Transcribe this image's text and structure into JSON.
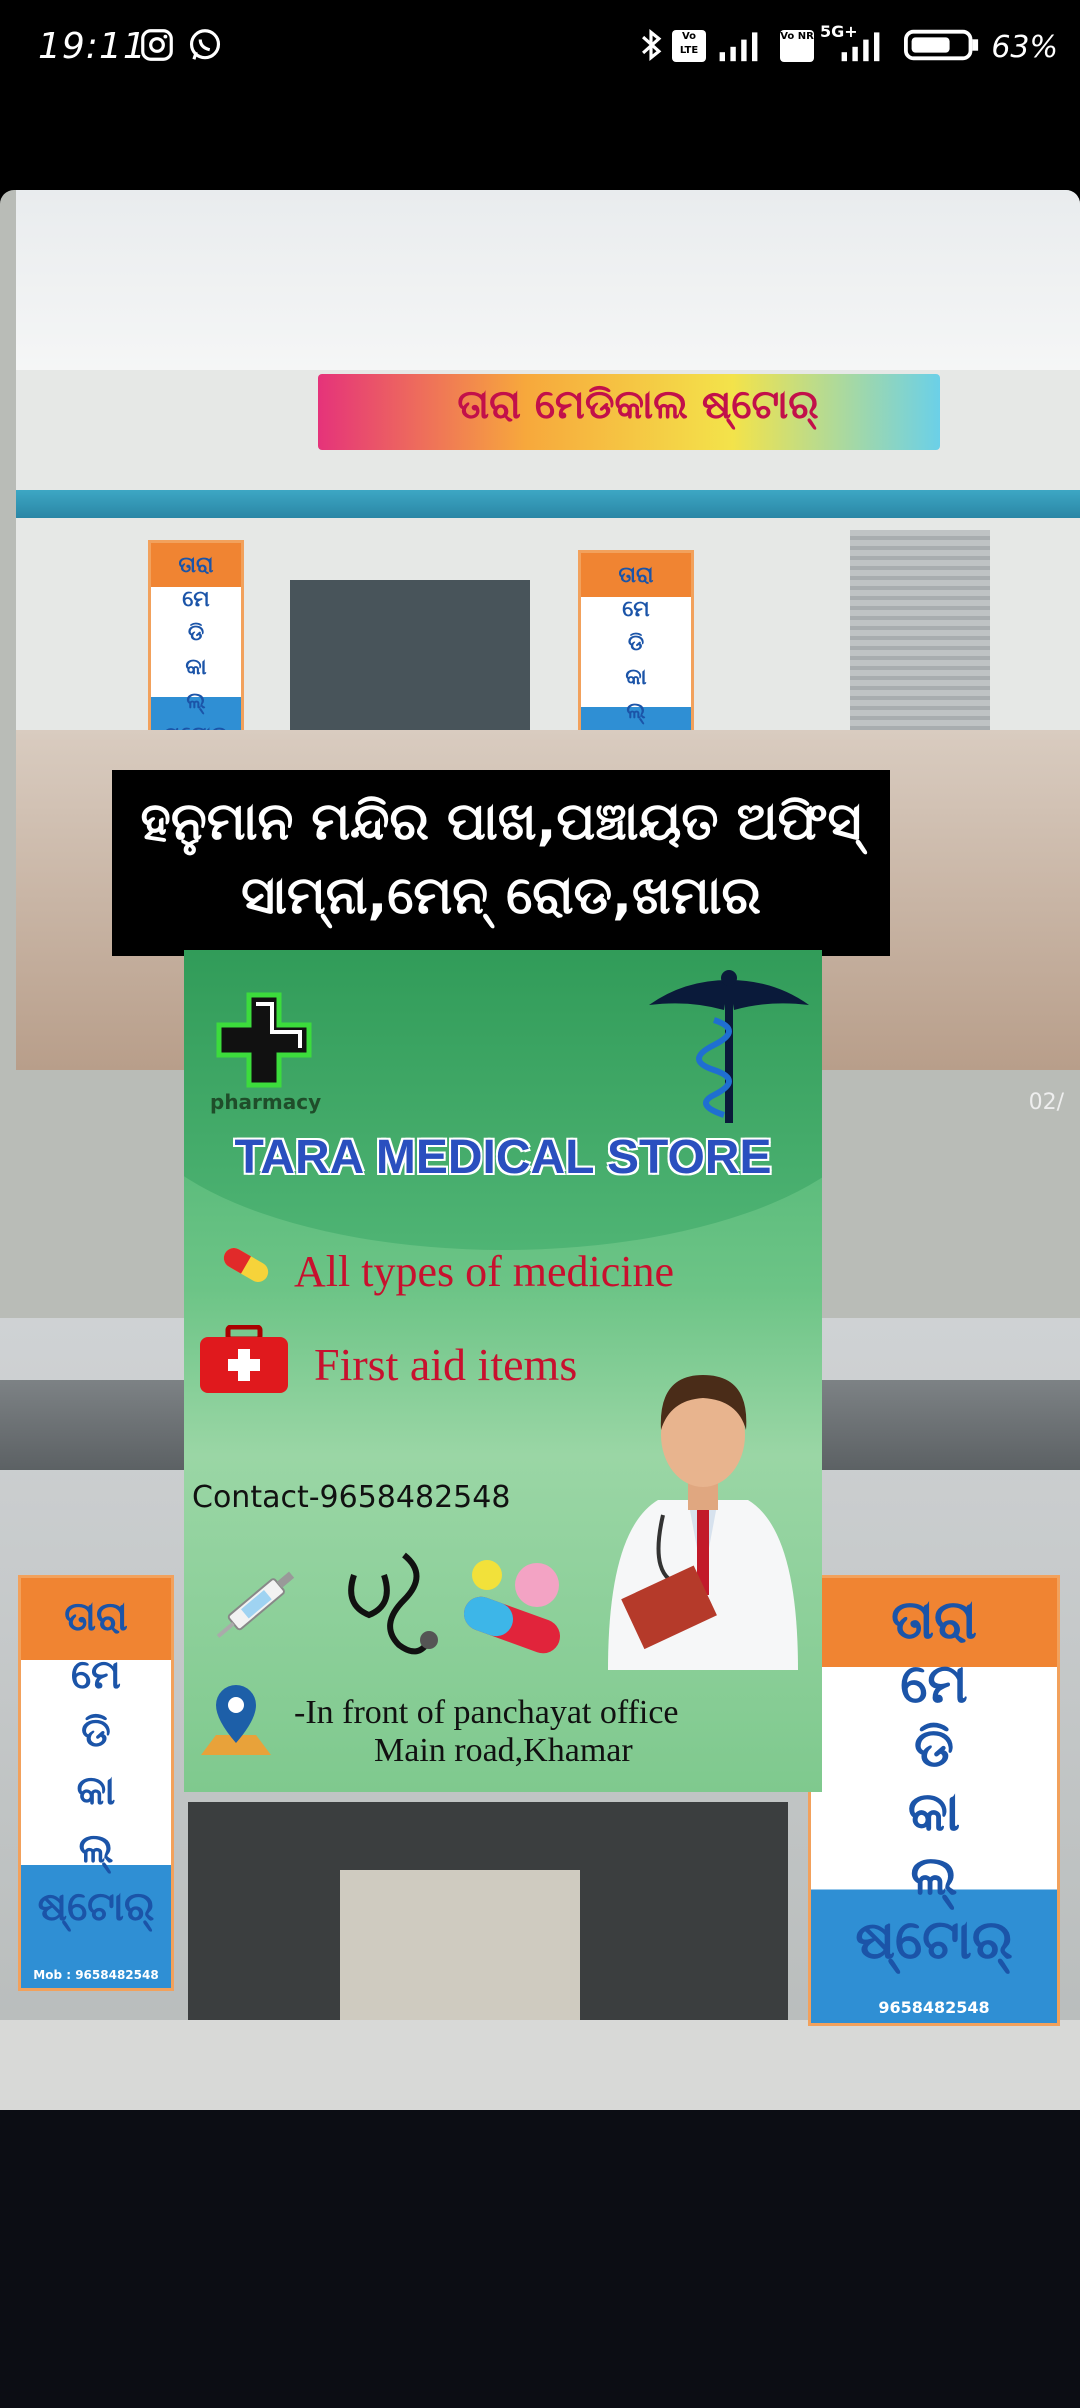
{
  "status_bar": {
    "time": "19:11",
    "battery": "63%",
    "icons": [
      "instagram-icon",
      "whatsapp-icon",
      "bluetooth-icon",
      "volte-icon",
      "signal-icon",
      "vonr-icon",
      "5g-icon",
      "battery-icon"
    ],
    "net_label_1": "Vo LTE",
    "net_label_2": "Vo NR",
    "net_label_3": "5G+"
  },
  "shop_banner": {
    "text": "ତାରା ମେଡିକାଲ ଷ୍ଟୋର୍"
  },
  "left_vertical_banner": {
    "text": "ତାରା\nମେ\nଡି\nକା\nଲ୍\nଷ୍ଟୋର୍",
    "mobile": "Mob : 9658482548"
  },
  "right_vertical_banner": {
    "text": "ତାରା\nମେ\nଡି\nକା\nଲ୍\nଷ୍ଟୋର୍",
    "mobile": "9658482548"
  },
  "address_band": {
    "line1": "ହନୁମାନ ମନ୍ଦିର ପାଖ,ପଞ୍ଚାୟତ ଅଫିସ୍",
    "line2": "ସାମ୍ନା,ମେନ୍ ରୋଡ,ଖମାର"
  },
  "poster": {
    "pharmacy_label": "pharmacy",
    "title": "TARA MEDICAL STORE",
    "item1": "All types of medicine",
    "item2": "First aid items",
    "contact": "Contact-9658482548",
    "address_line1": "-In front of panchayat office",
    "address_line2": "Main road,Khamar"
  },
  "watermark": "02/"
}
